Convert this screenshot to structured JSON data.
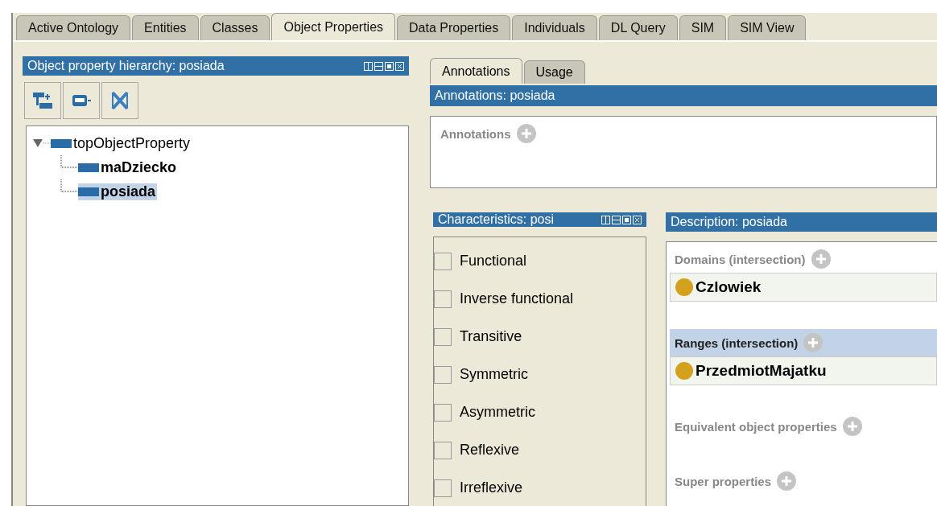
{
  "tabs": [
    {
      "label": "Active Ontology",
      "selected": false
    },
    {
      "label": "Entities",
      "selected": false
    },
    {
      "label": "Classes",
      "selected": false
    },
    {
      "label": "Object Properties",
      "selected": true
    },
    {
      "label": "Data Properties",
      "selected": false
    },
    {
      "label": "Individuals",
      "selected": false
    },
    {
      "label": "DL Query",
      "selected": false
    },
    {
      "label": "SIM",
      "selected": false
    },
    {
      "label": "SIM View",
      "selected": false
    }
  ],
  "hierarchy": {
    "title": "Object property hierarchy: posiada",
    "tree": [
      {
        "label": "topObjectProperty",
        "expanded": true,
        "selected": false,
        "children": [
          {
            "label": "maDziecko",
            "selected": false
          },
          {
            "label": "posiada",
            "selected": true
          }
        ]
      }
    ]
  },
  "annotations": {
    "subtabs": [
      {
        "label": "Annotations",
        "selected": true
      },
      {
        "label": "Usage",
        "selected": false
      }
    ],
    "title": "Annotations: posiada",
    "section": "Annotations"
  },
  "characteristics": {
    "title": "Characteristics: posi",
    "items": [
      {
        "label": "Functional",
        "checked": false
      },
      {
        "label": "Inverse functional",
        "checked": false
      },
      {
        "label": "Transitive",
        "checked": false
      },
      {
        "label": "Symmetric",
        "checked": false
      },
      {
        "label": "Asymmetric",
        "checked": false
      },
      {
        "label": "Reflexive",
        "checked": false
      },
      {
        "label": "Irreflexive",
        "checked": false
      }
    ]
  },
  "description": {
    "title": "Description: posiada",
    "sections": [
      {
        "label": "Domains (intersection)",
        "selected": false,
        "items": [
          "Czlowiek"
        ]
      },
      {
        "label": "Ranges (intersection)",
        "selected": true,
        "items": [
          "PrzedmiotMajatku"
        ]
      },
      {
        "label": "Equivalent object properties",
        "selected": false
      },
      {
        "label": "Super properties",
        "selected": false
      }
    ]
  }
}
